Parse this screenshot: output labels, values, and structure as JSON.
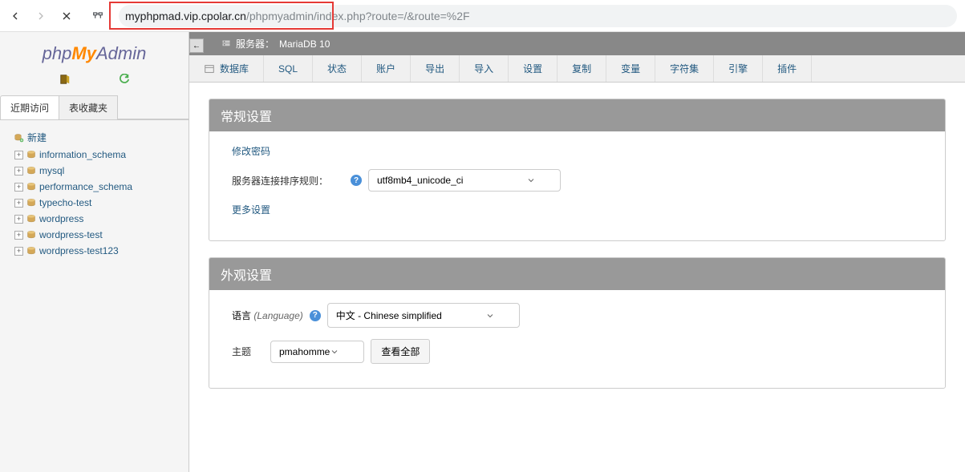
{
  "browser": {
    "url_main": "myphpmad.vip.cpolar.cn",
    "url_rest": "/phpmyadmin/index.php?route=/&route=%2F"
  },
  "logo": {
    "part1": "php",
    "part2": "My",
    "part3": "Admin"
  },
  "sidebar": {
    "tabs": [
      "近期访问",
      "表收藏夹"
    ],
    "new_label": "新建",
    "databases": [
      "information_schema",
      "mysql",
      "performance_schema",
      "typecho-test",
      "wordpress",
      "wordpress-test",
      "wordpress-test123"
    ]
  },
  "server": {
    "label": "服务器：",
    "name": "MariaDB 10"
  },
  "toptabs": [
    "数据库",
    "SQL",
    "状态",
    "账户",
    "导出",
    "导入",
    "设置",
    "复制",
    "变量",
    "字符集",
    "引擎",
    "插件"
  ],
  "panels": {
    "general": {
      "title": "常规设置",
      "change_password": "修改密码",
      "collation_label": "服务器连接排序规则：",
      "collation_value": "utf8mb4_unicode_ci",
      "more_settings": "更多设置"
    },
    "appearance": {
      "title": "外观设置",
      "language_label": "语言",
      "language_hint": "(Language)",
      "language_value": "中文 - Chinese simplified",
      "theme_label": "主题",
      "theme_value": "pmahomme",
      "view_all": "查看全部"
    }
  }
}
